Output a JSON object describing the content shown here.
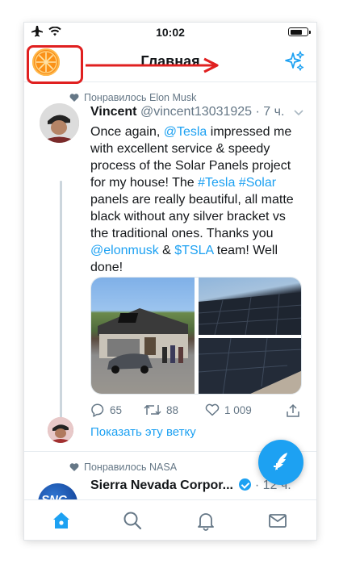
{
  "status_bar": {
    "time": "10:02"
  },
  "header": {
    "title": "Главная"
  },
  "tweets": [
    {
      "liked_by": "Понравилось Elon Musk",
      "name": "Vincent",
      "handle": "@vincent13031925",
      "time": "· 7 ч.",
      "text_parts": [
        {
          "t": "Once again, ",
          "link": false
        },
        {
          "t": "@Tesla",
          "link": true
        },
        {
          "t": " impressed me with excellent service & speedy process of the Solar Panels project for my house! The ",
          "link": false
        },
        {
          "t": "#Tesla",
          "link": true
        },
        {
          "t": " ",
          "link": false
        },
        {
          "t": "#Solar",
          "link": true
        },
        {
          "t": " panels are really beautiful, all matte black without any silver bracket vs the traditional ones. Thanks you ",
          "link": false
        },
        {
          "t": "@elonmusk",
          "link": true
        },
        {
          "t": " & ",
          "link": false
        },
        {
          "t": "$TSLA",
          "link": true
        },
        {
          "t": " team! Well done!",
          "link": false
        }
      ],
      "replies": "65",
      "retweets": "88",
      "likes": "1 009",
      "show_thread": "Показать эту ветку"
    },
    {
      "liked_by": "Понравилось NASA",
      "name": "Sierra Nevada Corpor...",
      "time": "· 12 ч.",
      "avatar_text": "SNC"
    }
  ],
  "icons": {
    "airplane": "airplane-icon",
    "wifi": "wifi-icon",
    "battery": "battery-icon",
    "sparkle": "sparkle-icon",
    "heart": "heart-icon",
    "reply": "reply-icon",
    "retweet": "retweet-icon",
    "like": "like-icon",
    "share": "share-icon",
    "compose": "compose-icon",
    "home": "home-icon",
    "search": "search-icon",
    "notifications": "bell-icon",
    "messages": "mail-icon"
  },
  "colors": {
    "accent": "#1da1f2",
    "highlight": "#e02020",
    "muted": "#657786"
  }
}
